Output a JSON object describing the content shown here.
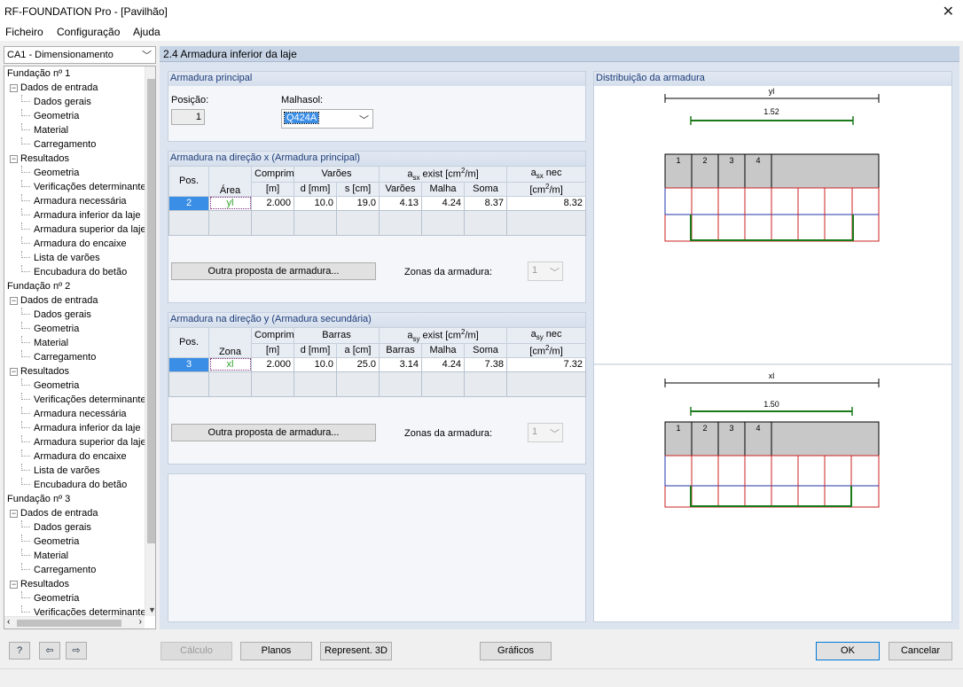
{
  "window": {
    "title": "RF-FOUNDATION Pro - [Pavilhão]",
    "close_glyph": "✕"
  },
  "menu": [
    "Ficheiro",
    "Configuração",
    "Ajuda"
  ],
  "case_select": {
    "value": "CA1 - Dimensionamento"
  },
  "tree": [
    {
      "label": "Fundação nº 1",
      "level": 0
    },
    {
      "label": "Dados de entrada",
      "level": 1,
      "toggle": "−"
    },
    {
      "label": "Dados gerais",
      "level": 2
    },
    {
      "label": "Geometria",
      "level": 2
    },
    {
      "label": "Material",
      "level": 2
    },
    {
      "label": "Carregamento",
      "level": 2
    },
    {
      "label": "Resultados",
      "level": 1,
      "toggle": "−"
    },
    {
      "label": "Geometria",
      "level": 2
    },
    {
      "label": "Verificações determinantes",
      "level": 2
    },
    {
      "label": "Armadura necessária",
      "level": 2
    },
    {
      "label": "Armadura inferior da laje",
      "level": 2,
      "selected": true
    },
    {
      "label": "Armadura superior da laje",
      "level": 2
    },
    {
      "label": "Armadura do encaixe",
      "level": 2
    },
    {
      "label": "Lista de varões",
      "level": 2
    },
    {
      "label": "Encubadura do betão",
      "level": 2
    },
    {
      "label": "Fundação nº 2",
      "level": 0
    },
    {
      "label": "Dados de entrada",
      "level": 1,
      "toggle": "−"
    },
    {
      "label": "Dados gerais",
      "level": 2
    },
    {
      "label": "Geometria",
      "level": 2
    },
    {
      "label": "Material",
      "level": 2
    },
    {
      "label": "Carregamento",
      "level": 2
    },
    {
      "label": "Resultados",
      "level": 1,
      "toggle": "−"
    },
    {
      "label": "Geometria",
      "level": 2
    },
    {
      "label": "Verificações determinantes",
      "level": 2
    },
    {
      "label": "Armadura necessária",
      "level": 2
    },
    {
      "label": "Armadura inferior da laje",
      "level": 2
    },
    {
      "label": "Armadura superior da laje",
      "level": 2
    },
    {
      "label": "Armadura do encaixe",
      "level": 2
    },
    {
      "label": "Lista de varões",
      "level": 2
    },
    {
      "label": "Encubadura do betão",
      "level": 2
    },
    {
      "label": "Fundação nº 3",
      "level": 0
    },
    {
      "label": "Dados de entrada",
      "level": 1,
      "toggle": "−"
    },
    {
      "label": "Dados gerais",
      "level": 2
    },
    {
      "label": "Geometria",
      "level": 2
    },
    {
      "label": "Material",
      "level": 2
    },
    {
      "label": "Carregamento",
      "level": 2
    },
    {
      "label": "Resultados",
      "level": 1,
      "toggle": "−"
    },
    {
      "label": "Geometria",
      "level": 2
    },
    {
      "label": "Verificações determinantes",
      "level": 2
    }
  ],
  "section_title": "2.4 Armadura inferior da laje",
  "main_rebar": {
    "title": "Armadura principal",
    "position_label": "Posição:",
    "position_value": "1",
    "mesh_label": "Malhasol:",
    "mesh_value": "Q424A"
  },
  "x_dir": {
    "title": "Armadura na direção x (Armadura principal)",
    "h_pos": "Pos.",
    "h_area": "Área",
    "h_len1": "Comprim.",
    "h_len2": "[m]",
    "h_bars": "Varões",
    "h_d": "d [mm]",
    "h_s": "s [cm]",
    "h_exist_a": "a",
    "h_exist_sub": "sx",
    "h_exist_b": " exist [cm",
    "h_exist_sup": "2",
    "h_exist_c": "/m]",
    "h_v": "Varões",
    "h_m": "Malha",
    "h_sum": "Soma",
    "h_nec_a": "a",
    "h_nec_sub": "sx",
    "h_nec_b": " nec",
    "h_nec_unit_a": "[cm",
    "h_nec_unit_sup": "2",
    "h_nec_unit_b": "/m]",
    "row": {
      "pos": "2",
      "area": "yl",
      "len": "2.000",
      "d": "10.0",
      "s": "19.0",
      "bars": "4.13",
      "mesh": "4.24",
      "sum": "8.37",
      "nec": "8.32"
    },
    "other_btn": "Outra proposta de armadura...",
    "zones_label": "Zonas da armadura:",
    "zones_value": "1"
  },
  "y_dir": {
    "title": "Armadura na direção y (Armadura secundária)",
    "h_pos": "Pos.",
    "h_area": "Zona",
    "h_len1": "Comprim.",
    "h_len2": "[m]",
    "h_bars": "Barras",
    "h_d": "d [mm]",
    "h_s": "a [cm]",
    "h_exist_a": "a",
    "h_exist_sub": "sy",
    "h_exist_b": " exist [cm",
    "h_exist_sup": "2",
    "h_exist_c": "/m]",
    "h_v": "Barras",
    "h_m": "Malha",
    "h_sum": "Soma",
    "h_nec_a": "a",
    "h_nec_sub": "sy",
    "h_nec_b": " nec",
    "h_nec_unit_a": "[cm",
    "h_nec_unit_sup": "2",
    "h_nec_unit_b": "/m]",
    "row": {
      "pos": "3",
      "area": "xl",
      "len": "2.000",
      "d": "10.0",
      "s": "25.0",
      "bars": "3.14",
      "mesh": "4.24",
      "sum": "7.38",
      "nec": "7.32"
    },
    "other_btn": "Outra proposta de armadura...",
    "zones_label": "Zonas da armadura:",
    "zones_value": "1"
  },
  "drawing": {
    "title": "Distribuição da armadura",
    "top": {
      "axis": "yl",
      "dim": "1.52",
      "cells": [
        "1",
        "2",
        "3",
        "4"
      ]
    },
    "bottom": {
      "axis": "xl",
      "dim": "1.50",
      "cells": [
        "1",
        "2",
        "3",
        "4"
      ]
    }
  },
  "bottom": {
    "calc": "Cálculo",
    "plans": "Planos",
    "rep3d": "Represent. 3D",
    "graphics": "Gráficos",
    "ok": "OK",
    "cancel": "Cancelar"
  },
  "colors": {
    "accent": "#3a8ee6",
    "header": "#c6d4e6",
    "green": "#1a7a1a",
    "red": "#cc2222",
    "blue": "#2233aa"
  }
}
